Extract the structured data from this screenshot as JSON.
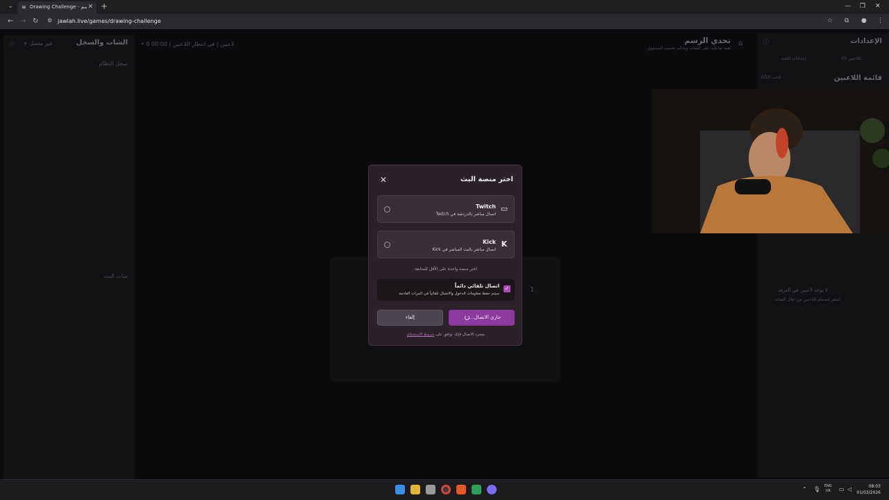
{
  "browser": {
    "tab_title": "Drawing Challenge - تحدي الرسم",
    "url": "jawlah.live/games/drawing-challenge"
  },
  "background_page": {
    "left_panel_title": "الشات والسجل",
    "left_button": "+ غير متصل",
    "left_log": "سجل النظام",
    "left_chat": "شات البث",
    "center_status": "• 0 لاعبين  |  في انتظار اللاعبين  |  00:00",
    "center_number": "1",
    "game_title": "تحدي الرسم",
    "game_subtitle": "لعبة تفاعلية على الشات وتحكم بحسب المسؤول",
    "settings_title": "الإعدادات",
    "tab_players": "اللاعبين (0)",
    "tab_game_settings": "إعدادات اللعبة",
    "players_list_title": "قائمة اللاعبين",
    "players_count": "0/10 لاعب",
    "empty_title": "لا يوجد لاعبين في الغرفة",
    "empty_desc": "انتظر انضمام اللاعبين من خلال الشات"
  },
  "modal": {
    "title": "اختر منصة البث",
    "options": [
      {
        "name": "Twitch",
        "desc": "اتصال مباشر بالدردشة في Twitch",
        "icon": "twitch-icon",
        "icon_glyph": "▭"
      },
      {
        "name": "Kick",
        "desc": "اتصال مباشر بالبث المباشر في Kick",
        "icon": "kick-icon",
        "icon_glyph": "K"
      }
    ],
    "hint": "اختر منصة واحدة على الأقل للمتابعة",
    "auto_connect_title": "اتصال تلقائي دائماً",
    "auto_connect_desc": "سيتم حفظ معلومات الدخول والاتصال تلقائياً في المرات القادمة",
    "auto_connect_checked": true,
    "cancel_label": "إلغاء",
    "connect_label": "جاري الاتصال...",
    "terms_prefix": "بمجرد الاتصال فإنك توافق على",
    "terms_link": "شروط الاستخدام"
  },
  "taskbar": {
    "lang_top": "ENG",
    "lang_bottom": "UK",
    "time": "08:03",
    "date": "01/03/2026"
  },
  "colors": {
    "accent": "#8d3aa0",
    "modal_bg": "#2a2129"
  }
}
